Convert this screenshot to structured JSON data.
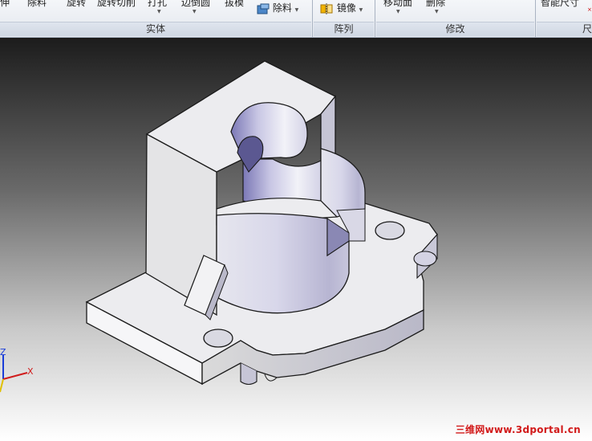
{
  "ribbon": {
    "buttons": [
      {
        "label": "伸"
      },
      {
        "label": "除料"
      },
      {
        "label": "旋转"
      },
      {
        "label": "旋转切削"
      },
      {
        "label": "打孔"
      },
      {
        "label": "边倒圆"
      },
      {
        "label": "拔模"
      },
      {
        "label": "除料"
      },
      {
        "label": "镜像"
      },
      {
        "label": "移动面"
      },
      {
        "label": "删除"
      },
      {
        "label": "智能尺寸"
      }
    ],
    "groups": [
      {
        "label": "实体"
      },
      {
        "label": "阵列"
      },
      {
        "label": "修改"
      },
      {
        "label": "尺"
      }
    ]
  },
  "triad": {
    "z": "Z",
    "x": "X"
  },
  "watermark": "三维网www.3dportal.cn"
}
